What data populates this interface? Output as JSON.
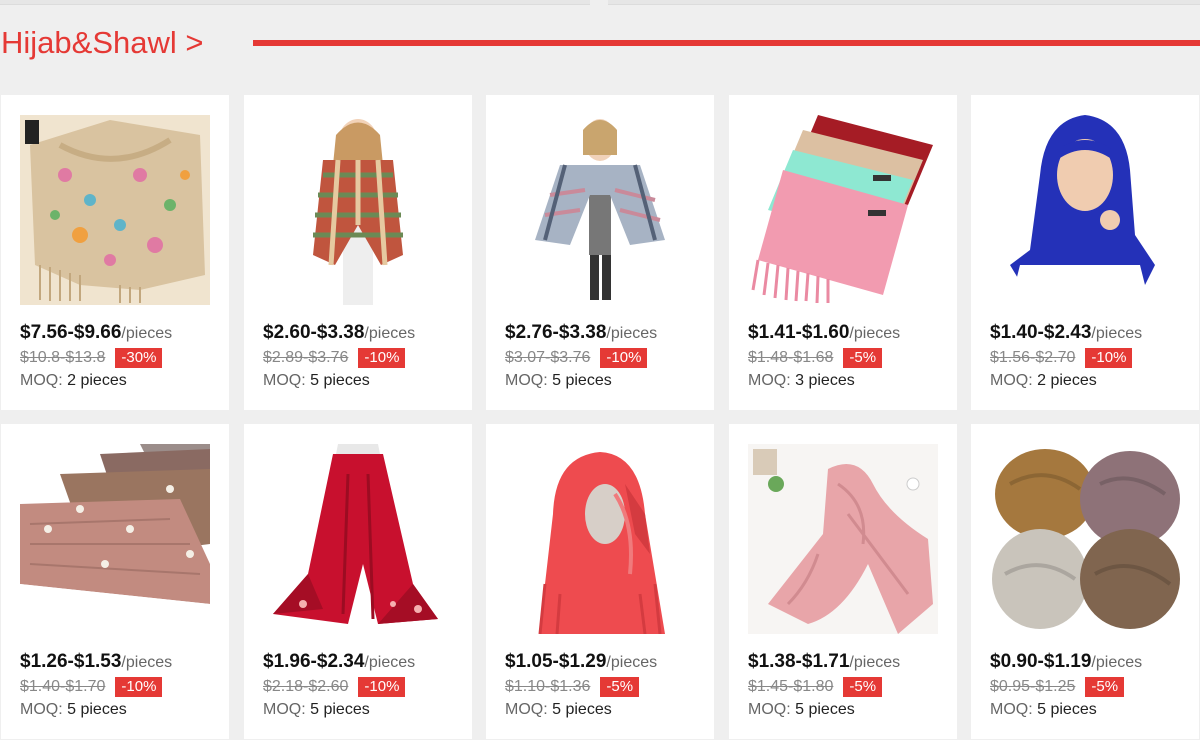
{
  "section": {
    "title": "Hijab&Shawl >"
  },
  "unit_label": "/pieces",
  "moq_label": "MOQ:",
  "colors": {
    "accent": "#e53935",
    "card_bg": "#ffffff",
    "page_bg": "#efefef"
  },
  "products": [
    {
      "price": "$7.56-$9.66",
      "original_price": "$10.8-$13.8",
      "discount": "-30%",
      "moq": "2 pieces",
      "image_icon": "embroidered-beige-shawl"
    },
    {
      "price": "$2.60-$3.38",
      "original_price": "$2.89-$3.76",
      "discount": "-10%",
      "moq": "5 pieces",
      "image_icon": "plaid-scarf-model"
    },
    {
      "price": "$2.76-$3.38",
      "original_price": "$3.07-$3.76",
      "discount": "-10%",
      "moq": "5 pieces",
      "image_icon": "grey-plaid-poncho-model"
    },
    {
      "price": "$1.41-$1.60",
      "original_price": "$1.48-$1.68",
      "discount": "-5%",
      "moq": "3 pieces",
      "image_icon": "stacked-pashmina-scarves"
    },
    {
      "price": "$1.40-$2.43",
      "original_price": "$1.56-$2.70",
      "discount": "-10%",
      "moq": "2 pieces",
      "image_icon": "blue-hijab-model"
    },
    {
      "price": "$1.26-$1.53",
      "original_price": "$1.40-$1.70",
      "discount": "-10%",
      "moq": "5 pieces",
      "image_icon": "pearl-crinkle-scarves"
    },
    {
      "price": "$1.96-$2.34",
      "original_price": "$2.18-$2.60",
      "discount": "-10%",
      "moq": "5 pieces",
      "image_icon": "red-lace-chiffon-scarf"
    },
    {
      "price": "$1.05-$1.29",
      "original_price": "$1.10-$1.36",
      "discount": "-5%",
      "moq": "5 pieces",
      "image_icon": "coral-lace-hijab-mannequin"
    },
    {
      "price": "$1.38-$1.71",
      "original_price": "$1.45-$1.80",
      "discount": "-5%",
      "moq": "5 pieces",
      "image_icon": "pink-cotton-scarf"
    },
    {
      "price": "$0.90-$1.19",
      "original_price": "$0.95-$1.25",
      "discount": "-5%",
      "moq": "5 pieces",
      "image_icon": "crinkle-cotton-hijabs"
    }
  ]
}
